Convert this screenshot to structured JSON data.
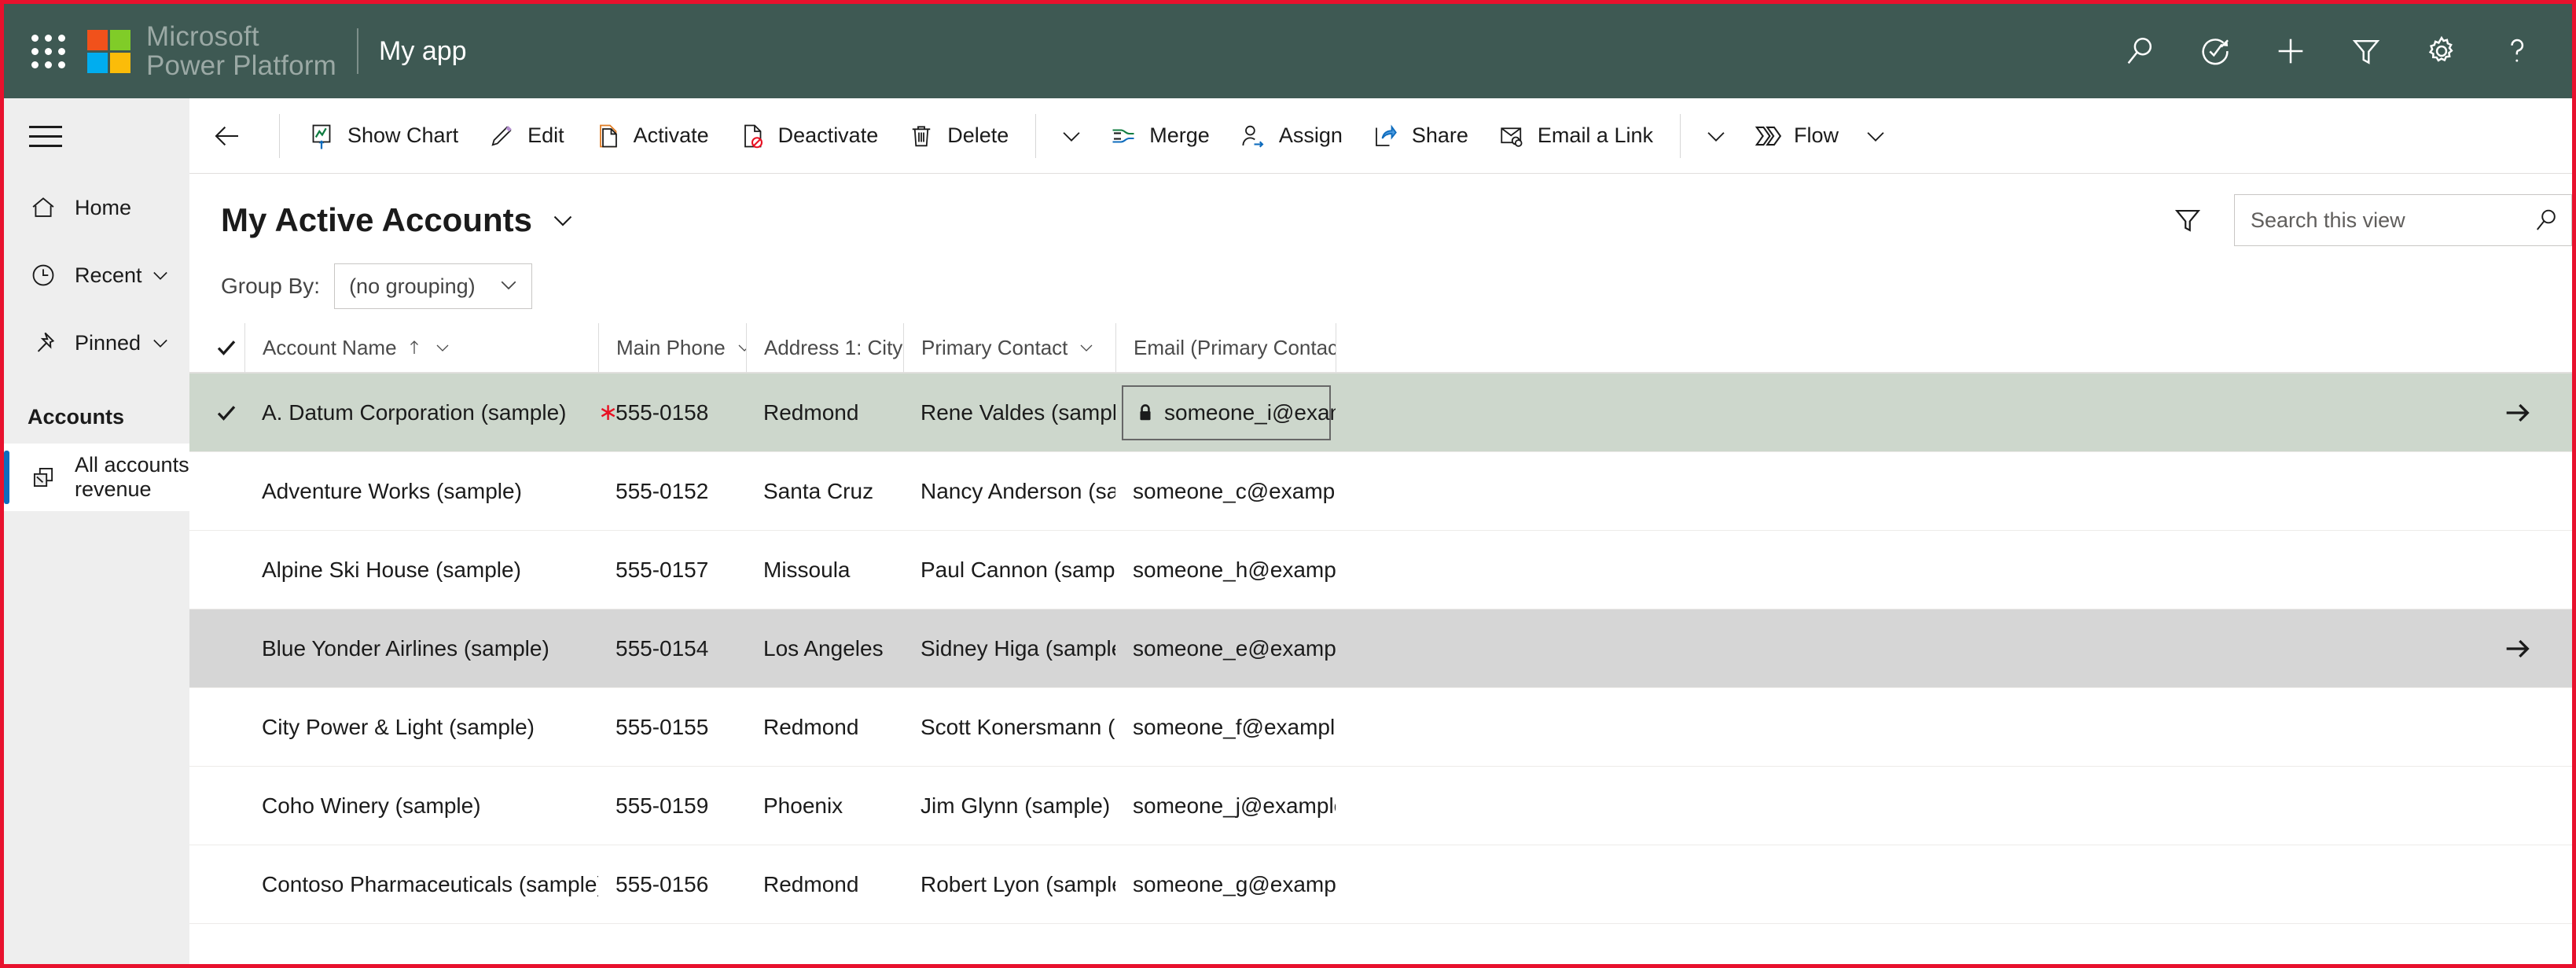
{
  "appbar": {
    "waffle_label": "app-launcher",
    "brand_line1": "Microsoft",
    "brand_line2": "Power Platform",
    "app_title": "My app",
    "bg_color": "#3e5953",
    "actions": [
      {
        "name": "search-icon",
        "label": "Search"
      },
      {
        "name": "assistant-icon",
        "label": "Quick Assist"
      },
      {
        "name": "plus-icon",
        "label": "New"
      },
      {
        "name": "filter-icon",
        "label": "Filter"
      },
      {
        "name": "gear-icon",
        "label": "Settings"
      },
      {
        "name": "help-icon",
        "label": "Help"
      }
    ]
  },
  "sidebar": {
    "hamburger_label": "Site Map",
    "items": [
      {
        "label": "Home",
        "icon": "home-icon",
        "chevron": false
      },
      {
        "label": "Recent",
        "icon": "clock-icon",
        "chevron": true
      },
      {
        "label": "Pinned",
        "icon": "pin-icon",
        "chevron": true
      }
    ],
    "group_title": "Accounts",
    "group_items": [
      {
        "label": "All accounts revenue",
        "icon": "dashboard-icon",
        "selected": true
      }
    ]
  },
  "commandbar": {
    "back_label": "Back",
    "buttons": [
      {
        "label": "Show Chart",
        "icon": "chart-icon"
      },
      {
        "label": "Edit",
        "icon": "pencil-icon"
      },
      {
        "label": "Activate",
        "icon": "activate-icon"
      },
      {
        "label": "Deactivate",
        "icon": "deactivate-icon"
      },
      {
        "label": "Delete",
        "icon": "trash-icon"
      }
    ],
    "overflow_1": "chevron-down-icon",
    "buttons2": [
      {
        "label": "Merge",
        "icon": "merge-icon"
      },
      {
        "label": "Assign",
        "icon": "assign-icon"
      },
      {
        "label": "Share",
        "icon": "share-icon"
      },
      {
        "label": "Email a Link",
        "icon": "email-link-icon"
      }
    ],
    "overflow_2": "chevron-down-icon",
    "buttons3": [
      {
        "label": "Flow",
        "icon": "flow-icon"
      }
    ],
    "overflow_3": "chevron-down-icon"
  },
  "view": {
    "title": "My Active Accounts",
    "title_chevron": "chevron-down-icon",
    "filter_icon": "filter-icon",
    "search": {
      "placeholder": "Search this view",
      "value": "",
      "icon": "search-icon"
    },
    "groupby": {
      "label": "Group By:",
      "selected": "(no grouping)",
      "chevron": "chevron-down-icon"
    }
  },
  "grid": {
    "columns": [
      {
        "label": "Account Name",
        "sort": "asc",
        "chevron": true
      },
      {
        "label": "Main Phone",
        "sort": "none",
        "chevron": true
      },
      {
        "label": "Address 1: City",
        "sort": "none",
        "chevron": true
      },
      {
        "label": "Primary Contact",
        "sort": "none",
        "chevron": true
      },
      {
        "label": "Email (Primary Contact)",
        "sort": "none",
        "chevron": true
      }
    ],
    "rows": [
      {
        "name": "A. Datum Corporation (sample)",
        "phone": "555-0158",
        "phone_required": true,
        "city": "Redmond",
        "contact": "Rene Valdes (sample)",
        "email": "someone_i@examp...",
        "email_locked": true,
        "email_boxed": true,
        "state": "selected",
        "checked": true,
        "arrow": true
      },
      {
        "name": "Adventure Works (sample)",
        "phone": "555-0152",
        "phone_required": false,
        "city": "Santa Cruz",
        "contact": "Nancy Anderson (sam...",
        "email": "someone_c@example....",
        "email_locked": false,
        "email_boxed": false,
        "state": "normal",
        "checked": false,
        "arrow": false
      },
      {
        "name": "Alpine Ski House (sample)",
        "phone": "555-0157",
        "phone_required": false,
        "city": "Missoula",
        "contact": "Paul Cannon (sample)",
        "email": "someone_h@example....",
        "email_locked": false,
        "email_boxed": false,
        "state": "normal",
        "checked": false,
        "arrow": false
      },
      {
        "name": "Blue Yonder Airlines (sample)",
        "phone": "555-0154",
        "phone_required": false,
        "city": "Los Angeles",
        "contact": "Sidney Higa (sample)",
        "email": "someone_e@example....",
        "email_locked": false,
        "email_boxed": false,
        "state": "hovered",
        "checked": false,
        "arrow": true
      },
      {
        "name": "City Power & Light (sample)",
        "phone": "555-0155",
        "phone_required": false,
        "city": "Redmond",
        "contact": "Scott Konersmann (sa...",
        "email": "someone_f@example....",
        "email_locked": false,
        "email_boxed": false,
        "state": "normal",
        "checked": false,
        "arrow": false
      },
      {
        "name": "Coho Winery (sample)",
        "phone": "555-0159",
        "phone_required": false,
        "city": "Phoenix",
        "contact": "Jim Glynn (sample)",
        "email": "someone_j@example.c...",
        "email_locked": false,
        "email_boxed": false,
        "state": "normal",
        "checked": false,
        "arrow": false
      },
      {
        "name": "Contoso Pharmaceuticals (sample)",
        "phone": "555-0156",
        "phone_required": false,
        "city": "Redmond",
        "contact": "Robert Lyon (sample)",
        "email": "someone_g@example....",
        "email_locked": false,
        "email_boxed": false,
        "state": "normal",
        "checked": false,
        "arrow": false
      }
    ]
  },
  "colors": {
    "header_bg": "#3e5953",
    "accent_blue": "#0f6cbd",
    "selected_row": "#cdd7cc",
    "hover_row": "#d6d6d6",
    "required_star": "#e81123",
    "logo_red": "#f1511b",
    "logo_green": "#80cc28",
    "logo_blue": "#00adef",
    "logo_yellow": "#fbbc09"
  }
}
